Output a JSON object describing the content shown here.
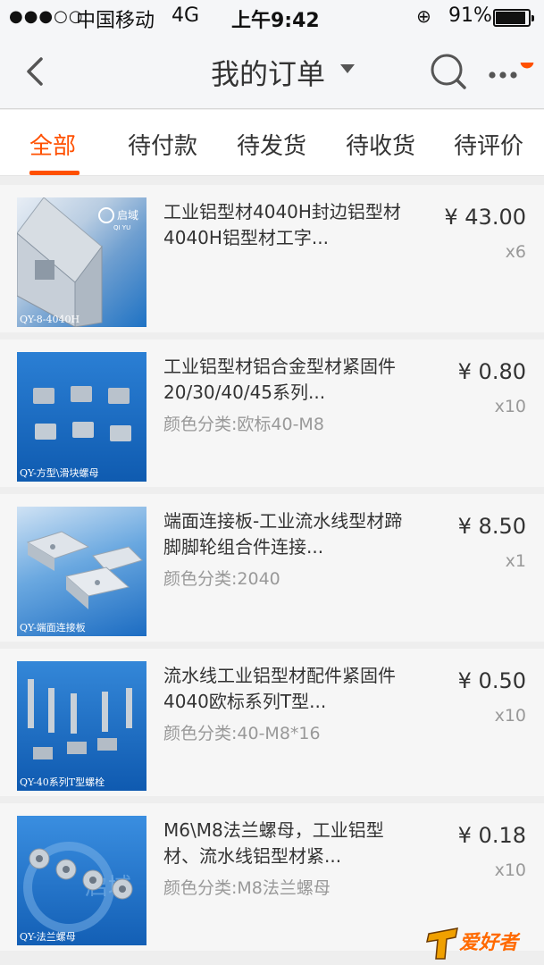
{
  "status_bar": {
    "signal": "●●●○○",
    "carrier": "中国移动",
    "network": "4G",
    "time": "上午9:42",
    "lock_icon": "orientation-lock-icon",
    "battery": "91%",
    "battery_level": 0.91
  },
  "nav": {
    "title": "我的订单",
    "back_icon": "back-chevron-icon",
    "search_icon": "search-icon",
    "more_icon": "more-dots-icon",
    "accent": "#ff5000"
  },
  "tabs": [
    {
      "label": "全部",
      "active": true
    },
    {
      "label": "待付款",
      "active": false
    },
    {
      "label": "待发货",
      "active": false
    },
    {
      "label": "待收货",
      "active": false
    },
    {
      "label": "待评价",
      "active": false
    }
  ],
  "orders": [
    {
      "title": "工业铝型材4040H封边铝型材4040H铝型材工字...",
      "sku": "",
      "price": "¥ 43.00",
      "qty": "x6",
      "thumb_caption": "QY-8-4040H"
    },
    {
      "title": "工业铝型材铝合金型材紧固件20/30/40/45系列...",
      "sku": "颜色分类:欧标40-M8",
      "price": "¥ 0.80",
      "qty": "x10",
      "thumb_caption": "QY-方型\\滑块螺母"
    },
    {
      "title": "端面连接板-工业流水线型材蹄脚脚轮组合件连接...",
      "sku": "颜色分类:2040",
      "price": "¥ 8.50",
      "qty": "x1",
      "thumb_caption": "QY-端面连接板"
    },
    {
      "title": "流水线工业铝型材配件紧固件4040欧标系列T型...",
      "sku": "颜色分类:40-M8*16",
      "price": "¥ 0.50",
      "qty": "x10",
      "thumb_caption": "QY-40系列T型螺栓"
    },
    {
      "title": "M6\\M8法兰螺母，工业铝型材、流水线铝型材紧...",
      "sku": "颜色分类:M8法兰螺母",
      "price": "¥ 0.18",
      "qty": "x10",
      "thumb_caption": "QY-法兰螺母"
    }
  ],
  "thumb_brand": {
    "name": "启域",
    "latin": "QI YU"
  },
  "watermark": {
    "text": "爱好者"
  }
}
